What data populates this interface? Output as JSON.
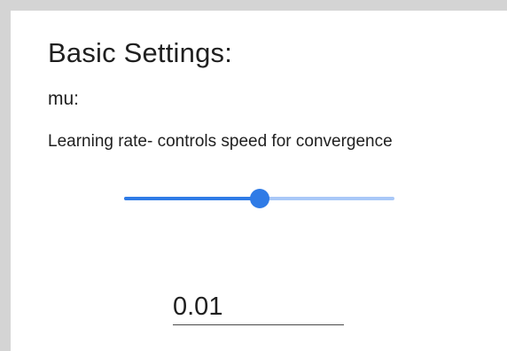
{
  "settings": {
    "title": "Basic Settings:",
    "param_name": "mu:",
    "param_description": "Learning rate- controls speed for convergence",
    "slider_level": 0.5,
    "value": "0.01"
  },
  "colors": {
    "accent": "#2f7be6",
    "track_inactive": "#a9c8f8",
    "frame": "#d4d4d4"
  }
}
